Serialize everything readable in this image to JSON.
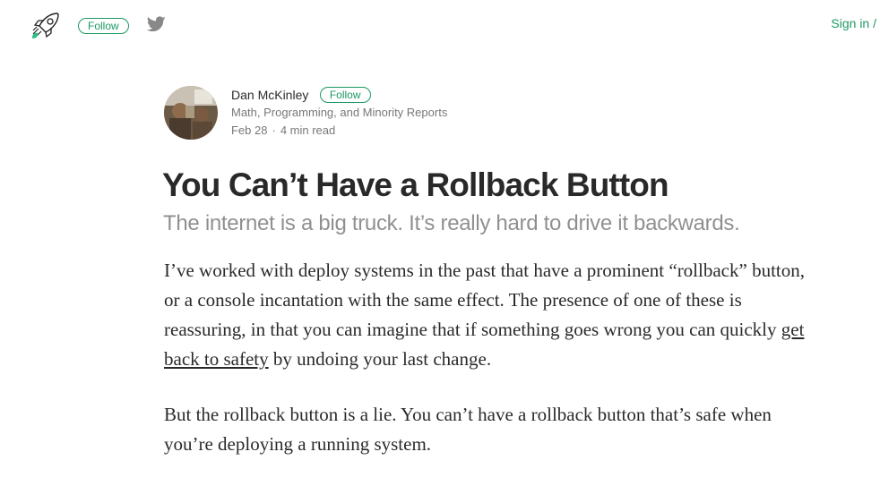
{
  "header": {
    "logo_icon": "rocket-icon",
    "follow_label": "Follow",
    "twitter_icon": "twitter-icon",
    "signin_label": "Sign in /",
    "accent_color": "#1c9963"
  },
  "author": {
    "avatar_icon": "author-avatar",
    "name": "Dan McKinley",
    "follow_label": "Follow",
    "bio": "Math, Programming, and Minority Reports",
    "date": "Feb 28",
    "separator": "·",
    "read_time": "4 min read"
  },
  "article": {
    "title": "You Can’t Have a Rollback Button",
    "subtitle": "The internet is a big truck. It’s really hard to drive it backwards.",
    "p1_before": "I’ve worked with deploy systems in the past that have a prominent “rollback” button, or a console incantation with the same effect. The presence of one of these is reassuring, in that you can imagine that if something goes wrong you can quickly ",
    "p1_link": "get back to safety",
    "p1_after": " by undoing your last change.",
    "p2": "But the rollback button is a lie. You can’t have a rollback button that’s safe when you’re deploying a running system."
  }
}
